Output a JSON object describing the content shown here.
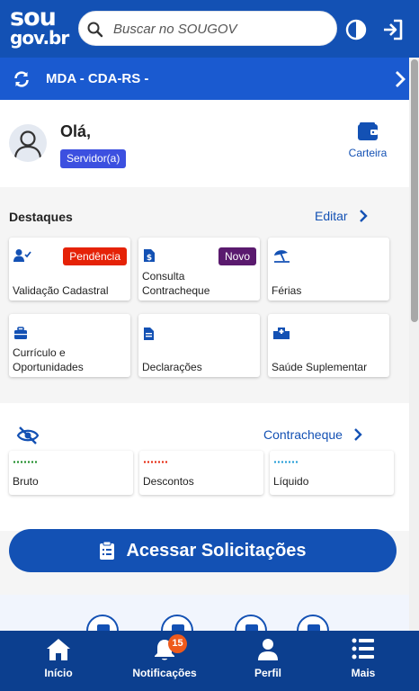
{
  "header": {
    "logo_line1": "sou",
    "logo_line2": "gov.br",
    "search_placeholder": "Buscar no SOUGOV",
    "icons": [
      "search-icon",
      "contrast-icon",
      "login-icon"
    ]
  },
  "org": {
    "name": "MDA - CDA-RS -"
  },
  "profile": {
    "greeting": "Olá,",
    "role_badge": "Servidor(a)",
    "wallet_label": "Carteira"
  },
  "highlights": {
    "title": "Destaques",
    "edit_label": "Editar",
    "cards": [
      {
        "label": "Validação Cadastral",
        "tag": "Pendência",
        "icon": "user-check-icon"
      },
      {
        "label": "Consulta Contracheque",
        "tag": "Novo",
        "icon": "document-dollar-icon"
      },
      {
        "label": "Férias",
        "tag": "",
        "icon": "beach-umbrella-icon"
      },
      {
        "label": "Currículo e Oportunidades",
        "tag": "",
        "icon": "briefcase-icon"
      },
      {
        "label": "Declarações",
        "tag": "",
        "icon": "document-icon"
      },
      {
        "label": "Saúde Suplementar",
        "tag": "",
        "icon": "hospital-icon"
      }
    ]
  },
  "paycheck": {
    "link_label": "Contracheque",
    "items": [
      {
        "label": "Bruto",
        "color": "#168821"
      },
      {
        "label": "Descontos",
        "color": "#e52207"
      },
      {
        "label": "Líquido",
        "color": "#1d9bd6"
      }
    ]
  },
  "cta": {
    "label": "Acessar Solicitações"
  },
  "bottom_nav": {
    "items": [
      {
        "label": "Início",
        "icon": "home-icon"
      },
      {
        "label": "Notificações",
        "icon": "bell-icon"
      },
      {
        "label": "Perfil",
        "icon": "user-icon"
      },
      {
        "label": "Mais",
        "icon": "menu-icon"
      }
    ],
    "notification_count": "15"
  },
  "colors": {
    "primary": "#1351b4",
    "org_bar": "#1a5ad0",
    "nav": "#0c3f8f",
    "badge_servidor": "#3c50e0",
    "tag_pendencia": "#e52207",
    "tag_novo": "#5a1a6e",
    "notif_badge": "#ee5a1b"
  }
}
